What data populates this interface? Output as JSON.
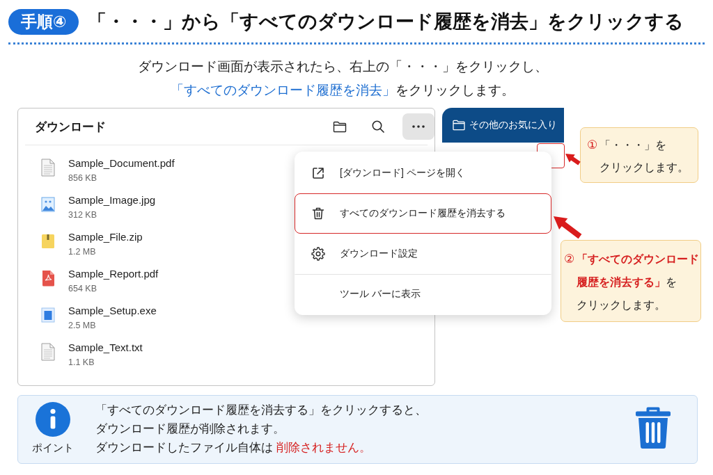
{
  "header": {
    "badge": "手順④",
    "title": "「・・・」から「すべてのダウンロード履歴を消去」をクリックする"
  },
  "intro": {
    "lines": [
      [
        {
          "text": "ダウンロード画面が表示されたら、右上の「・・・」をクリックし、",
          "accent": false
        }
      ],
      [
        {
          "text": "「すべてのダウンロード履歴を消去」",
          "accent": true
        },
        {
          "text": "をクリックします。",
          "accent": false
        }
      ]
    ]
  },
  "downloads_panel": {
    "title": "ダウンロード",
    "toolbar": [
      {
        "kind": "folder",
        "pressed": false
      },
      {
        "kind": "search",
        "pressed": false
      },
      {
        "kind": "more",
        "pressed": true
      }
    ],
    "files": [
      {
        "kind": "document",
        "name": "Sample_Document.pdf",
        "size": "856 KB"
      },
      {
        "kind": "image",
        "name": "Sample_Image.jpg",
        "size": "312 KB"
      },
      {
        "kind": "archive",
        "name": "Sample_File.zip",
        "size": "1.2 MB"
      },
      {
        "kind": "pdf",
        "name": "Sample_Report.pdf",
        "size": "654 KB"
      },
      {
        "kind": "installer",
        "name": "Sample_Setup.exe",
        "size": "2.5 MB"
      },
      {
        "kind": "text",
        "name": "Sample_Text.txt",
        "size": "1.1 KB"
      }
    ]
  },
  "favorites_button": {
    "label": "その他のお気に入り"
  },
  "menu": {
    "items": [
      {
        "kind": "open",
        "label": "[ダウンロード] ページを開く",
        "highlighted": false,
        "divider_above": false
      },
      {
        "kind": "delete",
        "label": "すべてのダウンロード履歴を消去する",
        "highlighted": true,
        "divider_above": false
      },
      {
        "kind": "settings",
        "label": "ダウンロード設定",
        "highlighted": false,
        "divider_above": false
      },
      {
        "kind": "plain",
        "label": "ツール バーに表示",
        "highlighted": false,
        "divider_above": true
      }
    ]
  },
  "callouts": [
    {
      "number": "①",
      "lines": [
        [
          {
            "text": "「・・・」を",
            "accent": false
          }
        ],
        [
          {
            "text": "クリックします。",
            "accent": false
          }
        ]
      ]
    },
    {
      "number": "②",
      "lines": [
        [
          {
            "text": "「すべてのダウンロード",
            "accent": true
          }
        ],
        [
          {
            "text": "履歴を消去する」",
            "accent": true
          },
          {
            "text": "を",
            "accent": false
          }
        ],
        [
          {
            "text": "クリックします。",
            "accent": false
          }
        ]
      ]
    }
  ],
  "note": {
    "label": "ポイント",
    "lines": [
      [
        {
          "text": "「すべてのダウンロード履歴を消去する」をクリックすると、",
          "accent": false
        }
      ],
      [
        {
          "text": "ダウンロード履歴が削除されます。",
          "accent": false
        }
      ],
      [
        {
          "text": "ダウンロードしたファイル自体は ",
          "accent": false
        },
        {
          "text": "削除されません。",
          "accent": true
        }
      ]
    ]
  }
}
